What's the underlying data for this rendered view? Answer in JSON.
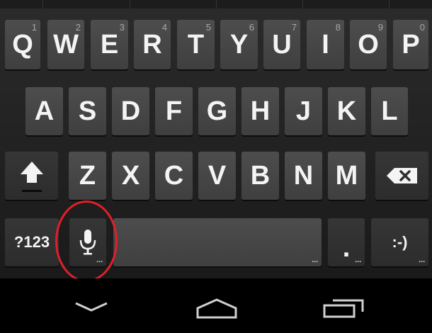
{
  "keyboard": {
    "row1": [
      {
        "letter": "Q",
        "hint": "1"
      },
      {
        "letter": "W",
        "hint": "2"
      },
      {
        "letter": "E",
        "hint": "3"
      },
      {
        "letter": "R",
        "hint": "4"
      },
      {
        "letter": "T",
        "hint": "5"
      },
      {
        "letter": "Y",
        "hint": "6"
      },
      {
        "letter": "U",
        "hint": "7"
      },
      {
        "letter": "I",
        "hint": "8"
      },
      {
        "letter": "O",
        "hint": "9"
      },
      {
        "letter": "P",
        "hint": "0"
      }
    ],
    "row2": [
      "A",
      "S",
      "D",
      "F",
      "G",
      "H",
      "J",
      "K",
      "L"
    ],
    "row3": [
      "Z",
      "X",
      "C",
      "V",
      "B",
      "N",
      "M"
    ],
    "row4": {
      "symbols_label": "?123",
      "period_label": ".",
      "emoticon_label": ":-)"
    },
    "icons": {
      "shift": "shift-arrow-up-icon",
      "backspace": "backspace-icon",
      "mic": "microphone-icon"
    }
  },
  "navigation": {
    "icons": [
      "back-chevron-icon",
      "home-icon",
      "recent-apps-icon"
    ]
  },
  "annotation": {
    "highlight_color": "#e21f2a",
    "highlight_target": "mic-key"
  },
  "colors": {
    "key_bg": "#474747",
    "keyboard_bg": "#222222",
    "nav_bg": "#000000",
    "text": "#f4f4f4"
  }
}
